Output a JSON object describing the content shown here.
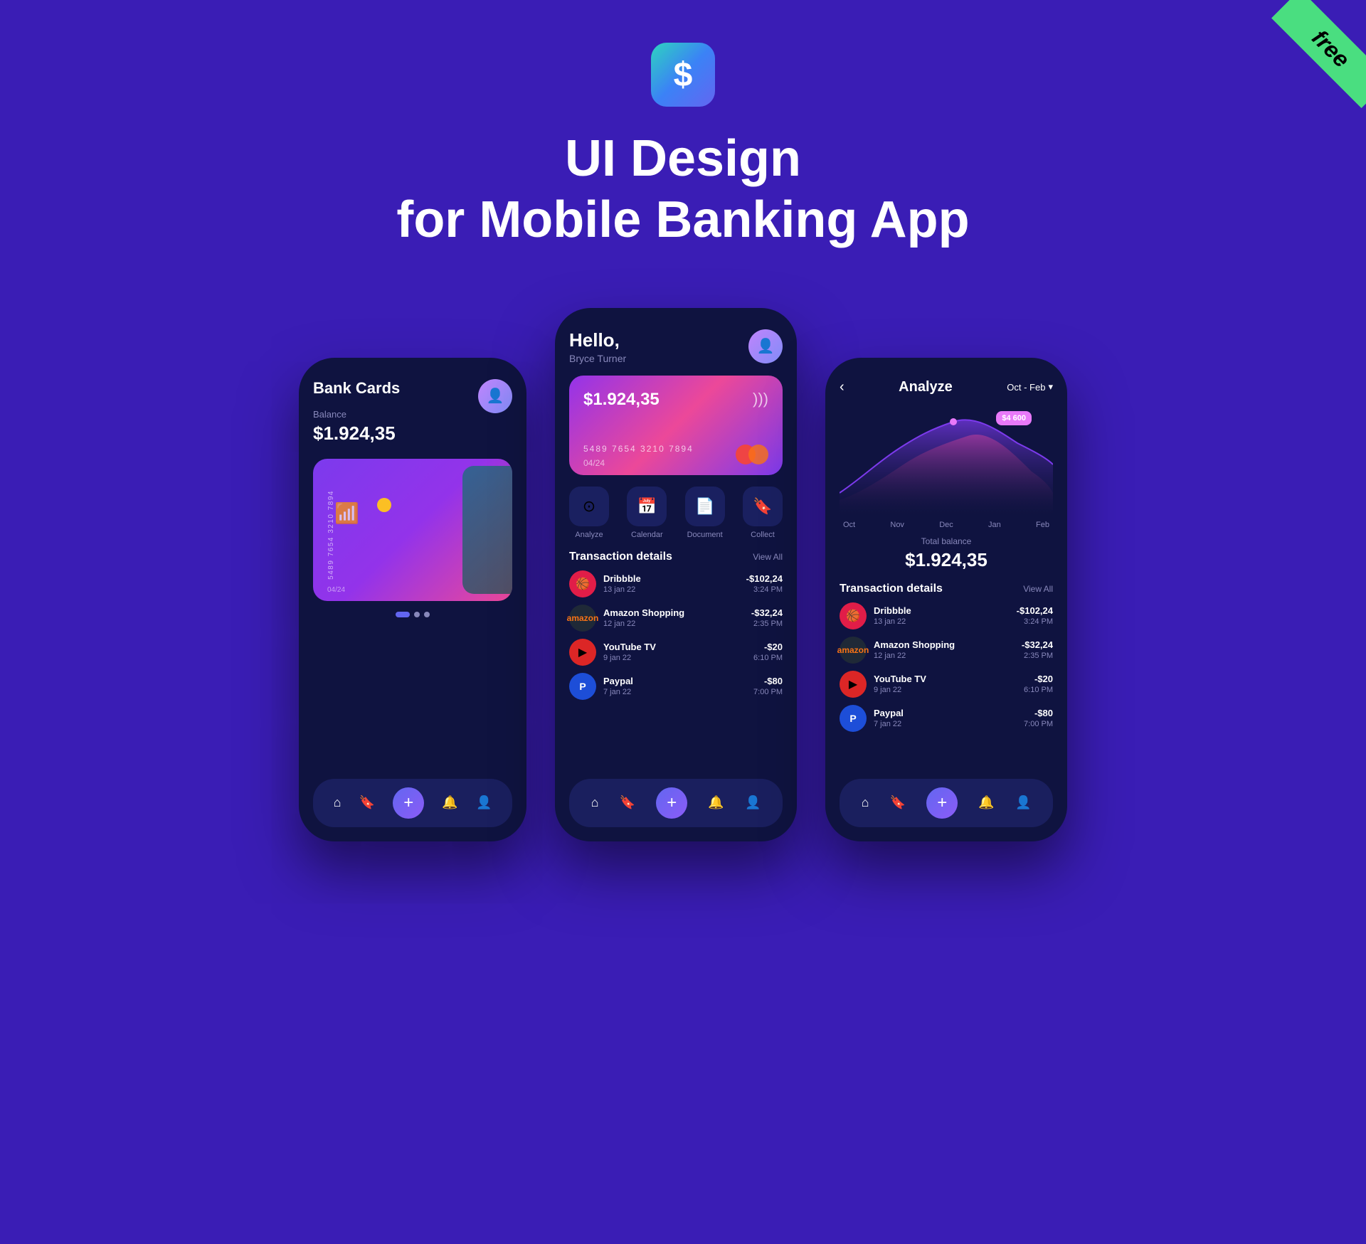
{
  "ribbon": {
    "label": "free"
  },
  "header": {
    "title_line1": "UI Design",
    "title_line2": "for Mobile Banking App",
    "app_icon": "$"
  },
  "phone_left": {
    "title": "Bank Cards",
    "balance_label": "Balance",
    "balance": "$1.924,35",
    "card_number": "5489 7654 3210 7894",
    "card_expiry": "04/24",
    "dots": [
      "active",
      "inactive",
      "inactive"
    ]
  },
  "phone_center": {
    "greeting": "Hello,",
    "user_name": "Bryce Turner",
    "card_balance": "$1.924,35",
    "card_number": "5489 7654 3210 7894",
    "card_expiry": "04/24",
    "actions": [
      {
        "label": "Analyze",
        "icon": "⊙"
      },
      {
        "label": "Calendar",
        "icon": "📅"
      },
      {
        "label": "Document",
        "icon": "📄"
      },
      {
        "label": "Collect",
        "icon": "🔖"
      }
    ],
    "transactions_title": "Transaction details",
    "view_all": "View All",
    "transactions": [
      {
        "name": "Dribbble",
        "date": "13 jan 22",
        "amount": "-$102,24",
        "time": "3:24 PM",
        "type": "dribbble"
      },
      {
        "name": "Amazon Shopping",
        "date": "12 jan 22",
        "amount": "-$32,24",
        "time": "2:35 PM",
        "type": "amazon"
      },
      {
        "name": "YouTube TV",
        "date": "9 jan 22",
        "amount": "-$20",
        "time": "6:10 PM",
        "type": "youtube"
      },
      {
        "name": "Paypal",
        "date": "7 jan 22",
        "amount": "-$80",
        "time": "7:00 PM",
        "type": "paypal"
      }
    ]
  },
  "phone_right": {
    "back_label": "‹",
    "title": "Analyze",
    "period": "Oct - Feb",
    "chart_tooltip": "$4 600",
    "chart_labels": [
      "Oct",
      "Nov",
      "Dec",
      "Jan",
      "Feb"
    ],
    "total_balance_label": "Total balance",
    "total_balance": "$1.924,35",
    "transactions_title": "Transaction details",
    "view_all": "View All",
    "transactions": [
      {
        "name": "Dribbble",
        "date": "13 jan 22",
        "amount": "-$102,24",
        "time": "3:24 PM",
        "type": "dribbble"
      },
      {
        "name": "Amazon Shopping",
        "date": "12 jan 22",
        "amount": "-$32,24",
        "time": "2:35 PM",
        "type": "amazon"
      },
      {
        "name": "YouTube TV",
        "date": "9 jan 22",
        "amount": "-$20",
        "time": "6:10 PM",
        "type": "youtube"
      },
      {
        "name": "Paypal",
        "date": "7 jan 22",
        "amount": "-$80",
        "time": "7:00 PM",
        "type": "paypal"
      }
    ]
  },
  "nav": {
    "home": "⌂",
    "bookmark": "🔖",
    "plus": "+",
    "bell": "🔔",
    "user": "👤"
  }
}
